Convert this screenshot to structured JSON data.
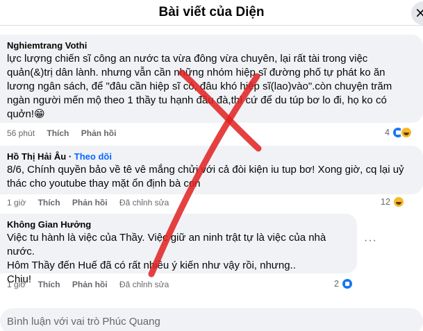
{
  "header": {
    "title": "Bài viết của Diện",
    "close_glyph": "×"
  },
  "comments": [
    {
      "author": "Nghiemtrang Vothi",
      "follow": "",
      "lines": [
        "lực lượng chiến sĩ công an nước ta vừa đông vừa chuyên, lại rất tài trong việc",
        "quản(&)trị dân lành. nhưng vẫn cần những nhóm hiệp sĩ đường phố tự phát ko ăn",
        "lương ngân sách, để \"đâu cần hiệp sĩ có, đâu khó hiệp sĩ(lao)vào\".còn chuyện trăm",
        "ngàn người mến mộ theo 1 thầy tu hạnh đầu đà,thì cứ để du túp bơ lo đi, họ ko có",
        "quởn!😁"
      ],
      "time": "56 phút",
      "like_label": "Thích",
      "reply_label": "Phản hồi",
      "edited": "",
      "reaction_count": "4",
      "reactions": [
        "like-icon",
        "haha-icon"
      ]
    },
    {
      "author": "Hồ Thị Hải Âu",
      "follow": "Theo dõi",
      "lines": [
        "8/6, Chính quyền bảo về tê vê mắng chửi với cả đòi kiện iu tup bơ! Xong giờ, cq lại uỷ",
        "thác cho youtube thay mặt ổn định bà con"
      ],
      "time": "1 giờ",
      "like_label": "Thích",
      "reply_label": "Phản hồi",
      "edited": "Đã chỉnh sửa",
      "reaction_count": "12",
      "reactions": [
        "haha-icon"
      ]
    },
    {
      "author": "Không Gian Hưởng",
      "follow": "",
      "lines": [
        "Việc tu hành là việc của Thầy. Việc giữ an ninh trật tự là việc của nhà nước.",
        "Hôm Thầy đến Huế đã có rất nhiều ý kiến như vậy rồi, nhưng..",
        "Chịu!"
      ],
      "time": "1 giờ",
      "like_label": "Thích",
      "reply_label": "Phản hồi",
      "edited": "Đã chỉnh sửa",
      "reaction_count": "2",
      "reactions": [
        "like-icon"
      ],
      "more_glyph": "···"
    }
  ],
  "composer": {
    "placeholder": "Bình luận với vai trò Phúc Quang"
  },
  "overlay": {
    "mark": "red-x-mark",
    "color": "#e02020"
  }
}
